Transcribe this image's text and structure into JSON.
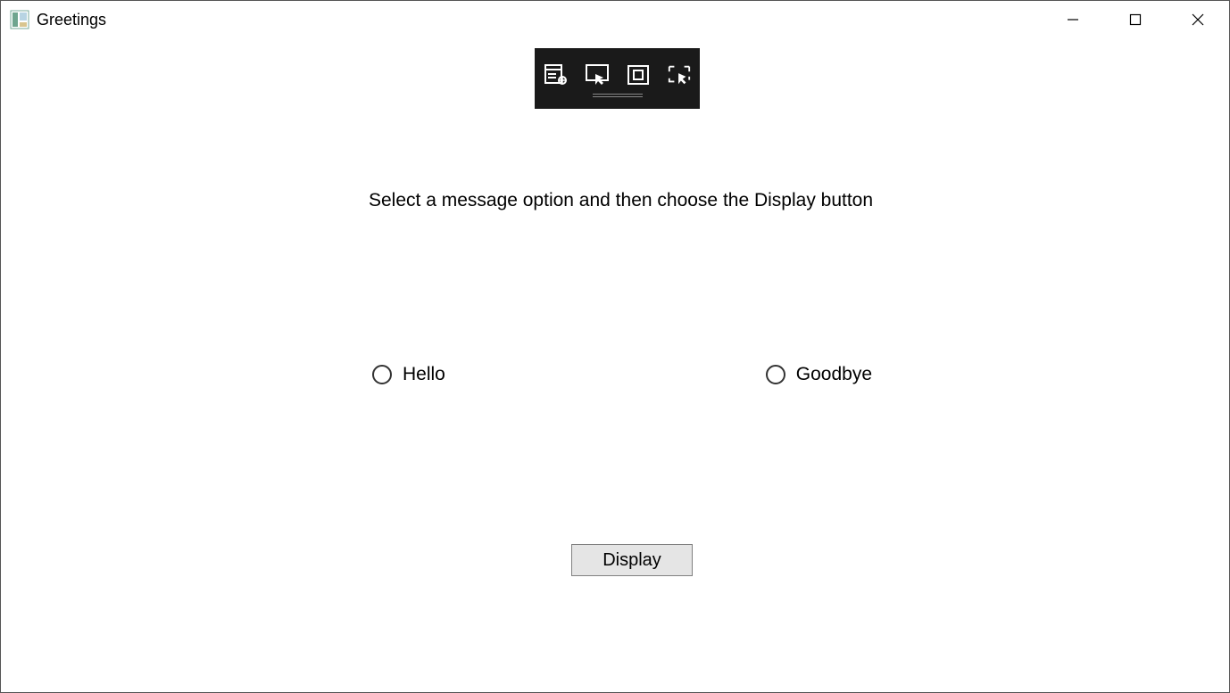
{
  "window": {
    "title": "Greetings"
  },
  "content": {
    "instruction": "Select a message option and then choose the Display button",
    "radios": {
      "hello": "Hello",
      "goodbye": "Goodbye"
    },
    "display_button": "Display"
  }
}
